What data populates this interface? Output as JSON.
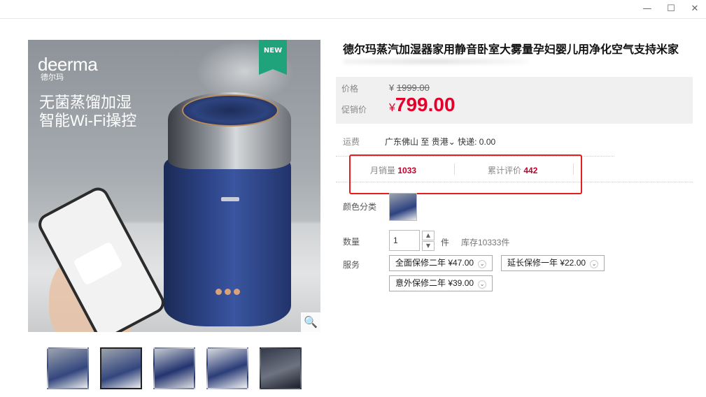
{
  "window": {
    "minimize_glyph": "—",
    "maximize_glyph": "☐",
    "close_glyph": "✕"
  },
  "gallery": {
    "brand_en": "deerma",
    "brand_cn": "德尔玛",
    "slogan_line1": "无菌蒸馏加湿",
    "slogan_line2": "智能Wi-Fi操控",
    "badge": "NEW",
    "zoom_icon": "search-icon",
    "zoom_glyph": "🔍",
    "thumbnail_count": 5,
    "active_thumbnail": 2
  },
  "product": {
    "title": "德尔玛蒸汽加湿器家用静音卧室大雾量孕妇婴儿用净化空气支持米家",
    "price_label": "价格",
    "original_price_symbol": "¥",
    "original_price": "1999.00",
    "promo_label": "促销价",
    "promo_price_symbol": "¥",
    "promo_price": "799.00",
    "shipping_label": "运费",
    "shipping_from": "广东佛山",
    "shipping_to_word": "至",
    "shipping_to": "贵港",
    "shipping_fee": "快递: 0.00",
    "monthly_sales_label": "月销量",
    "monthly_sales": "1033",
    "reviews_label": "累计评价",
    "reviews": "442",
    "color_label": "颜色分类",
    "quantity_label": "数量",
    "quantity_value": "1",
    "quantity_unit": "件",
    "stock": "库存10333件",
    "service_label": "服务",
    "services": [
      "全面保修二年 ¥47.00",
      "延长保修一年 ¥22.00",
      "意外保修二年 ¥39.00"
    ]
  },
  "colors": {
    "price_red": "#e4002b",
    "highlight_border": "#e21e1e",
    "badge_green": "#1fa37a"
  }
}
